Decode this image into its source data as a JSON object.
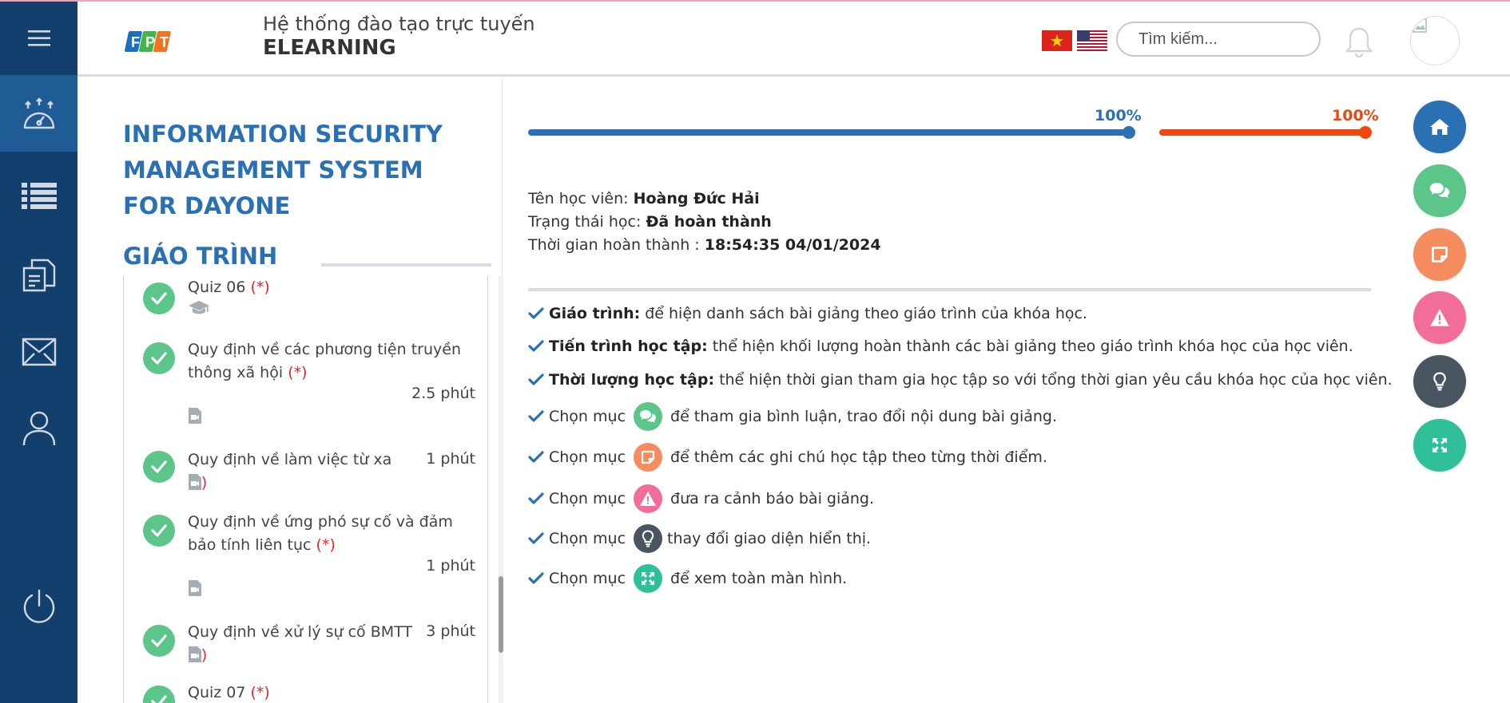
{
  "header": {
    "system_subtitle": "Hệ thống đào tạo trực tuyến",
    "system_title": "ELEARNING",
    "logo_text": "FPT",
    "search_placeholder": "Tìm kiếm...",
    "languages": [
      "vi",
      "en"
    ]
  },
  "sidebar": {
    "items": [
      {
        "icon": "menu-icon"
      },
      {
        "icon": "dashboard-icon",
        "active": true
      },
      {
        "icon": "list-icon"
      },
      {
        "icon": "documents-icon"
      },
      {
        "icon": "mail-icon"
      },
      {
        "icon": "user-icon"
      },
      {
        "icon": "power-icon"
      }
    ]
  },
  "course": {
    "title": "INFORMATION SECURITY MANAGEMENT SYSTEM FOR DAYONE",
    "syllabus_heading": "GIÁO TRÌNH"
  },
  "lessons": [
    {
      "name": "Quiz 06",
      "required": "(*)",
      "duration": "",
      "type": "quiz-icon",
      "completed": true
    },
    {
      "name": "Quy định về các phương tiện truyền thông xã hội",
      "required": "(*)",
      "duration": "2.5 phút",
      "type": "video-file-icon",
      "completed": true
    },
    {
      "name": "Quy định về làm việc từ xa",
      "required": "(*)",
      "duration": "1 phút",
      "type": "video-file-icon",
      "completed": true
    },
    {
      "name": "Quy định về ứng phó sự cố và đảm bảo tính liên tục",
      "required": "(*)",
      "duration": "1 phút",
      "type": "video-file-icon",
      "completed": true
    },
    {
      "name": "Quy định về xử lý sự cố BMTT",
      "required": "(*)",
      "duration": "3 phút",
      "type": "video-file-icon",
      "completed": true
    },
    {
      "name": "Quiz 07",
      "required": "(*)",
      "duration": "",
      "type": "quiz-icon",
      "completed": true
    }
  ],
  "progress": {
    "learning_progress": {
      "label": "100%",
      "value": 1.0,
      "color": "#2a70b5"
    },
    "learning_time": {
      "label": "100%",
      "value": 1.0,
      "color": "#f0460f"
    }
  },
  "student": {
    "name_label": "Tên học viên:",
    "name_value": "Hoàng Đức Hải",
    "status_label": "Trạng thái học:",
    "status_value": "Đã hoàn thành",
    "completion_label": "Thời gian hoàn thành :",
    "completion_value": "18:54:35 04/01/2024"
  },
  "guide": {
    "syllabus_term": "Giáo trình:",
    "syllabus_desc": "để hiện danh sách bài giảng theo giáo trình của khóa học.",
    "progress_term": "Tiến trình học tập:",
    "progress_desc": "thể hiện khối lượng hoàn thành các bài giảng theo giáo trình khóa học của học viên.",
    "duration_term": "Thời lượng học tập:",
    "duration_desc": "thể hiện thời gian tham gia học tập so với tổng thời gian yêu cầu khóa học của học viên.",
    "choose_label": "Chọn mục",
    "comment_desc": "để tham gia bình luận, trao đổi nội dung bài giảng.",
    "note_desc": "để thêm các ghi chú học tập theo từng thời điểm.",
    "warning_desc": "đưa ra cảnh báo bài giảng.",
    "theme_desc": "thay đổi giao diện hiển thị.",
    "fullscreen_desc": "để xem toàn màn hình."
  },
  "actions": [
    {
      "icon": "home-icon",
      "color": "#2a70b5"
    },
    {
      "icon": "comment-icon",
      "color": "#5cc58a"
    },
    {
      "icon": "note-icon",
      "color": "#f58c60"
    },
    {
      "icon": "warning-icon",
      "color": "#f26d9a"
    },
    {
      "icon": "lightbulb-icon",
      "color": "#4a5562"
    },
    {
      "icon": "fullscreen-icon",
      "color": "#2fc09a"
    }
  ]
}
